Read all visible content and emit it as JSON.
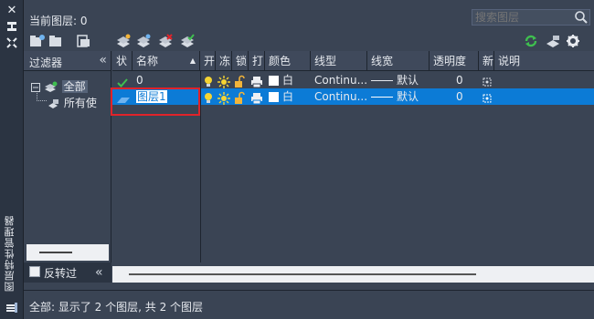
{
  "window": {
    "title": "图层特性管理器",
    "current_layer": "当前图层: 0"
  },
  "search": {
    "placeholder": "搜索图层"
  },
  "filter": {
    "title": "过滤器",
    "collapse_label": "«",
    "tree": {
      "all": "全部",
      "used": "所有使"
    },
    "invert_label": "反转过"
  },
  "grid": {
    "headers": [
      "状",
      "名称",
      "开",
      "冻",
      "锁",
      "打",
      "颜色",
      "线型",
      "线宽",
      "透明度",
      "新",
      "说明"
    ],
    "rows": [
      {
        "status": "current",
        "name": "0",
        "color_name": "白",
        "color_hex": "#ffffff",
        "linetype": "Continu...",
        "lineweight": "默认",
        "transparency": "0",
        "selected": false
      },
      {
        "status": "normal",
        "name": "图层1",
        "color_name": "白",
        "color_hex": "#ffffff",
        "linetype": "Continu...",
        "lineweight": "默认",
        "transparency": "0",
        "selected": true
      }
    ]
  },
  "status": {
    "text": "全部: 显示了 2 个图层, 共 2 个图层"
  },
  "colors": {
    "accent": "#0c7bd6",
    "highlight": "#e0232a",
    "panel": "#3a4454"
  }
}
